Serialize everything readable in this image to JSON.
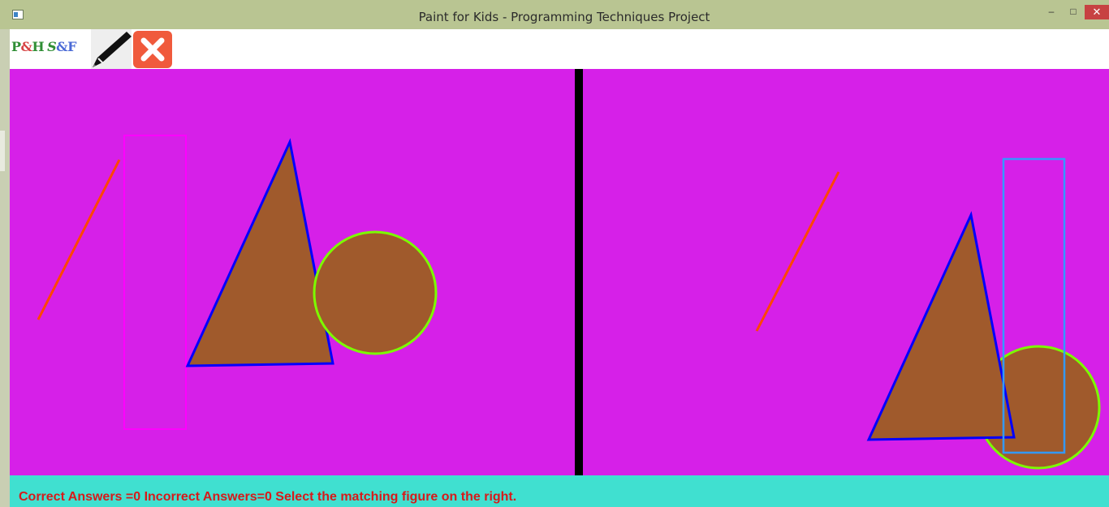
{
  "window": {
    "title": "Paint for Kids - Programming Techniques Project",
    "minimize_glyph": "‒",
    "maximize_glyph": "□",
    "close_glyph": "✕"
  },
  "toolbar": {
    "logo_text": "P&H S&F",
    "logo_parts": [
      "P",
      "&",
      "H",
      "S",
      "&F"
    ],
    "tools": [
      {
        "name": "draw-mode",
        "icon": "pencil-icon"
      },
      {
        "name": "exit",
        "icon": "close-x-icon"
      }
    ]
  },
  "canvas": {
    "background": "#d620e8",
    "divider_color": "#000000",
    "fill_color": "#a05a2c",
    "left_figures": [
      "line",
      "rectangle",
      "triangle",
      "circle"
    ],
    "right_figures": [
      "line",
      "triangle",
      "circle",
      "rectangle"
    ],
    "colors": {
      "line": "#ff4500",
      "rectangle_left": "#ff00ff",
      "rectangle_right": "#3399ff",
      "triangle_border": "#0000ff",
      "circle_border": "#7cfc00"
    }
  },
  "status": {
    "message": "Correct Answers =0 Incorrect Answers=0 Select the matching figure on the right.",
    "background": "#40e0d0",
    "text_color": "#d71a1a"
  }
}
